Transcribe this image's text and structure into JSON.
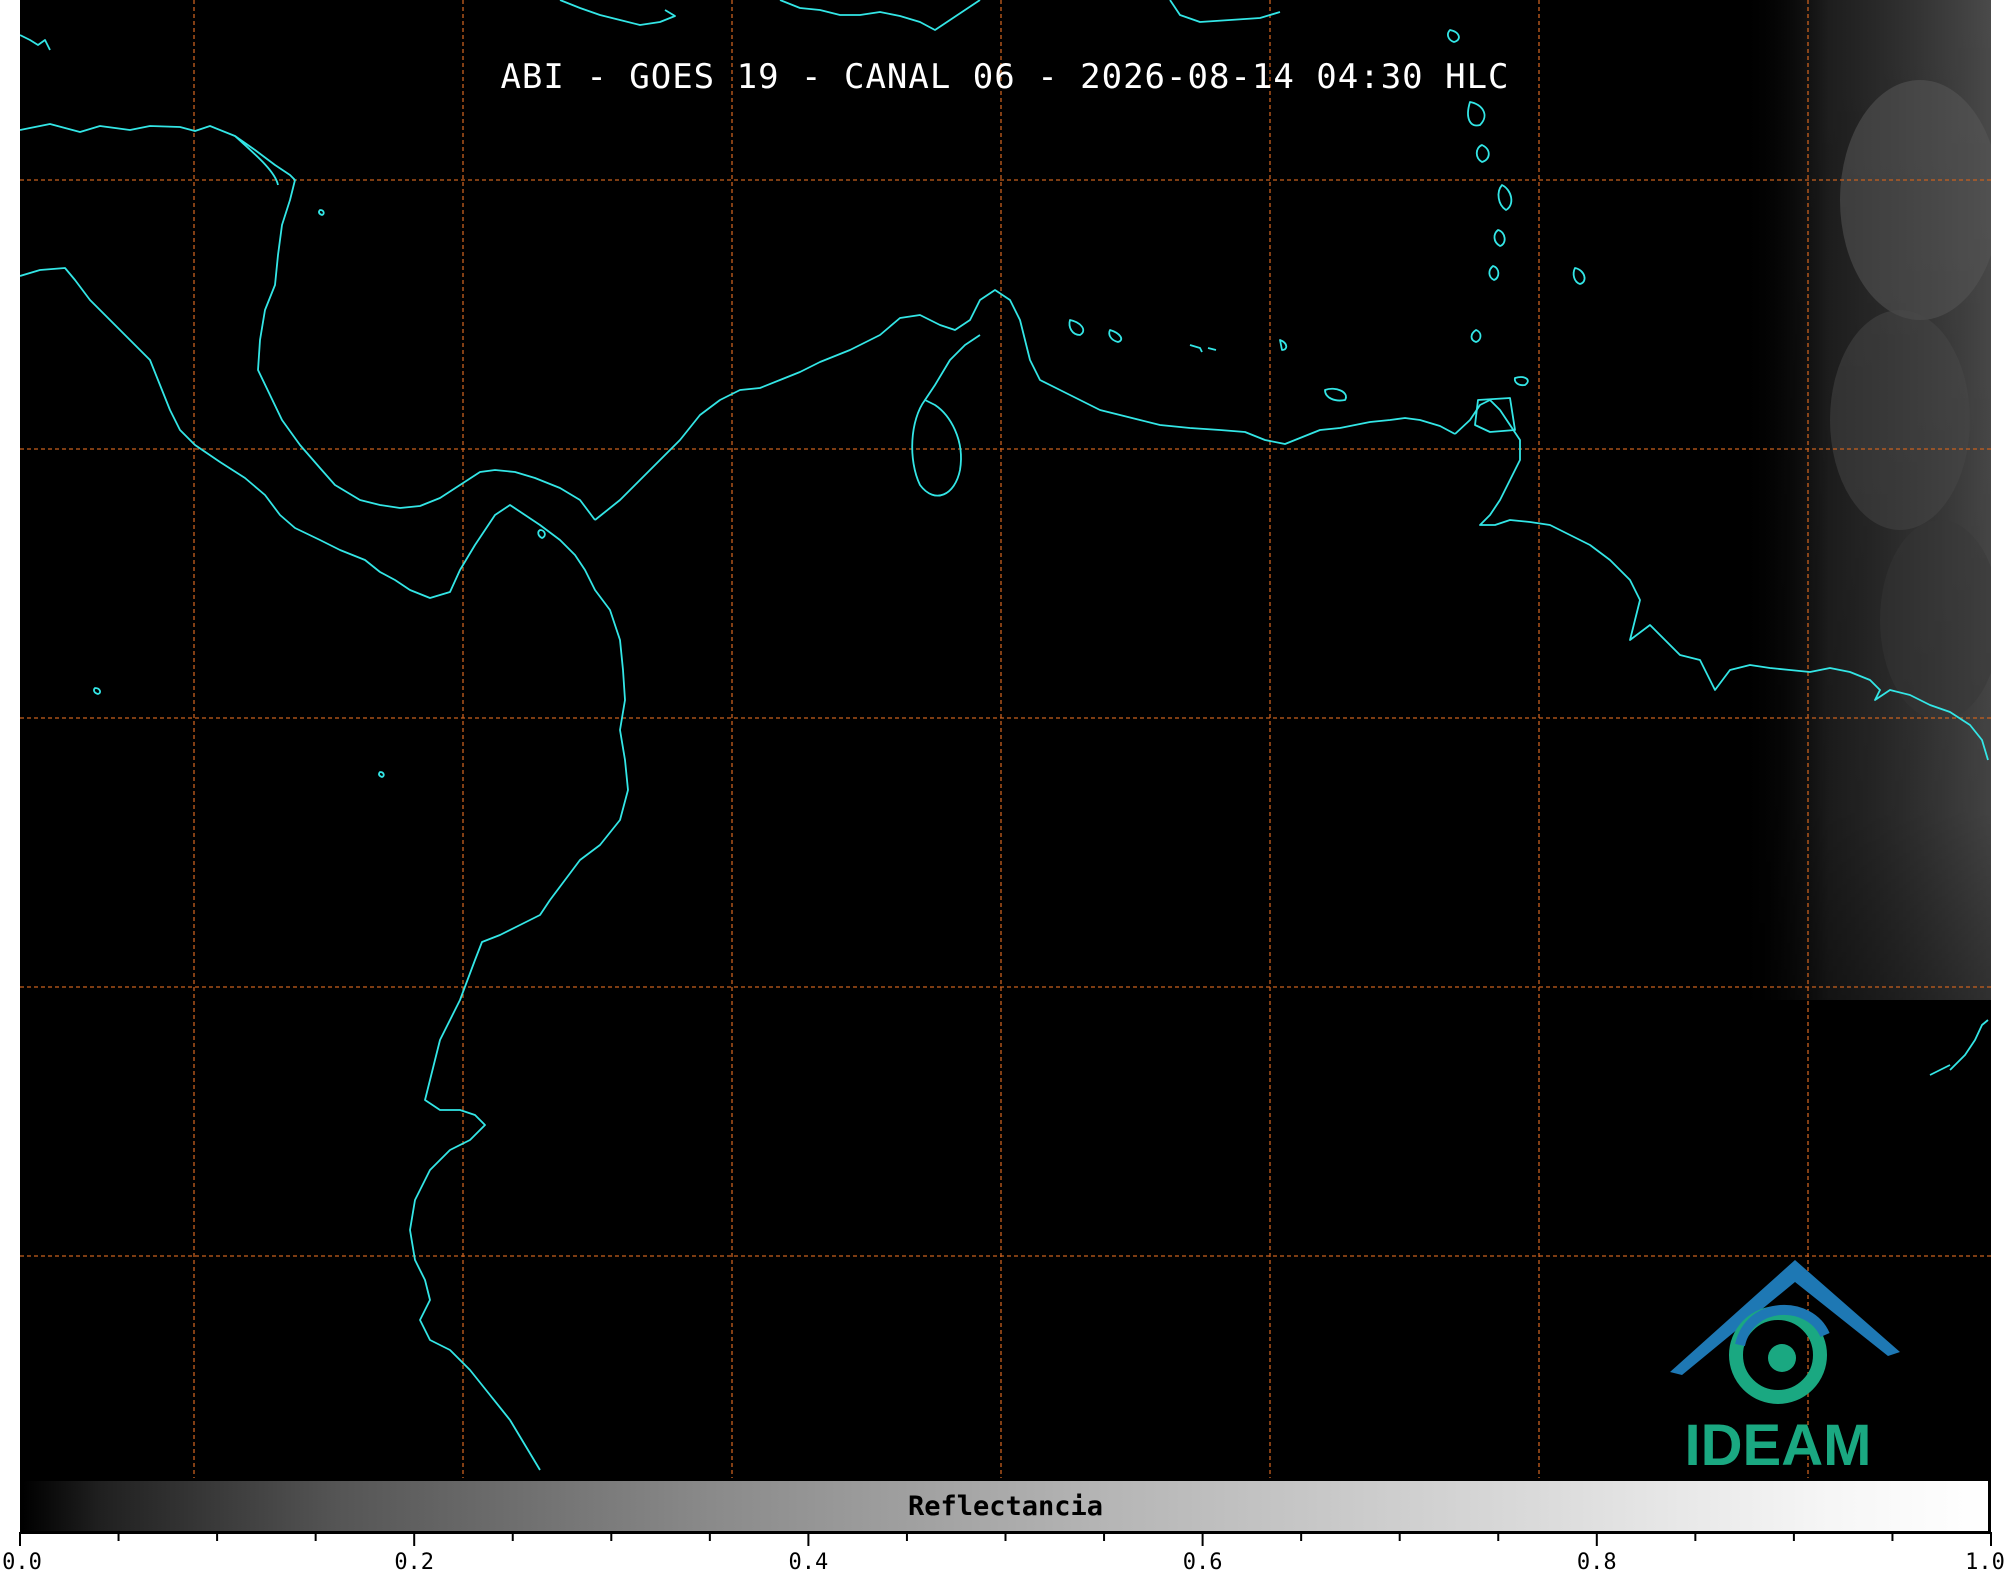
{
  "title": "ABI - GOES 19 - CANAL 06 - 2026-08-14 04:30 HLC",
  "map": {
    "background": "#000000",
    "coastline_color": "#33e6e6",
    "grid_color": "#c8601e",
    "grid_style": "dashed"
  },
  "logo": {
    "text": "IDEAM",
    "color": "#1aa881",
    "accent": "#1e78b4"
  },
  "colorbar": {
    "label": "Reflectancia",
    "min": 0.0,
    "max": 1.0,
    "tick_labels": [
      "0.0",
      "0.2",
      "0.4",
      "0.6",
      "0.8",
      "1.0"
    ],
    "colormap": "grayscale"
  }
}
